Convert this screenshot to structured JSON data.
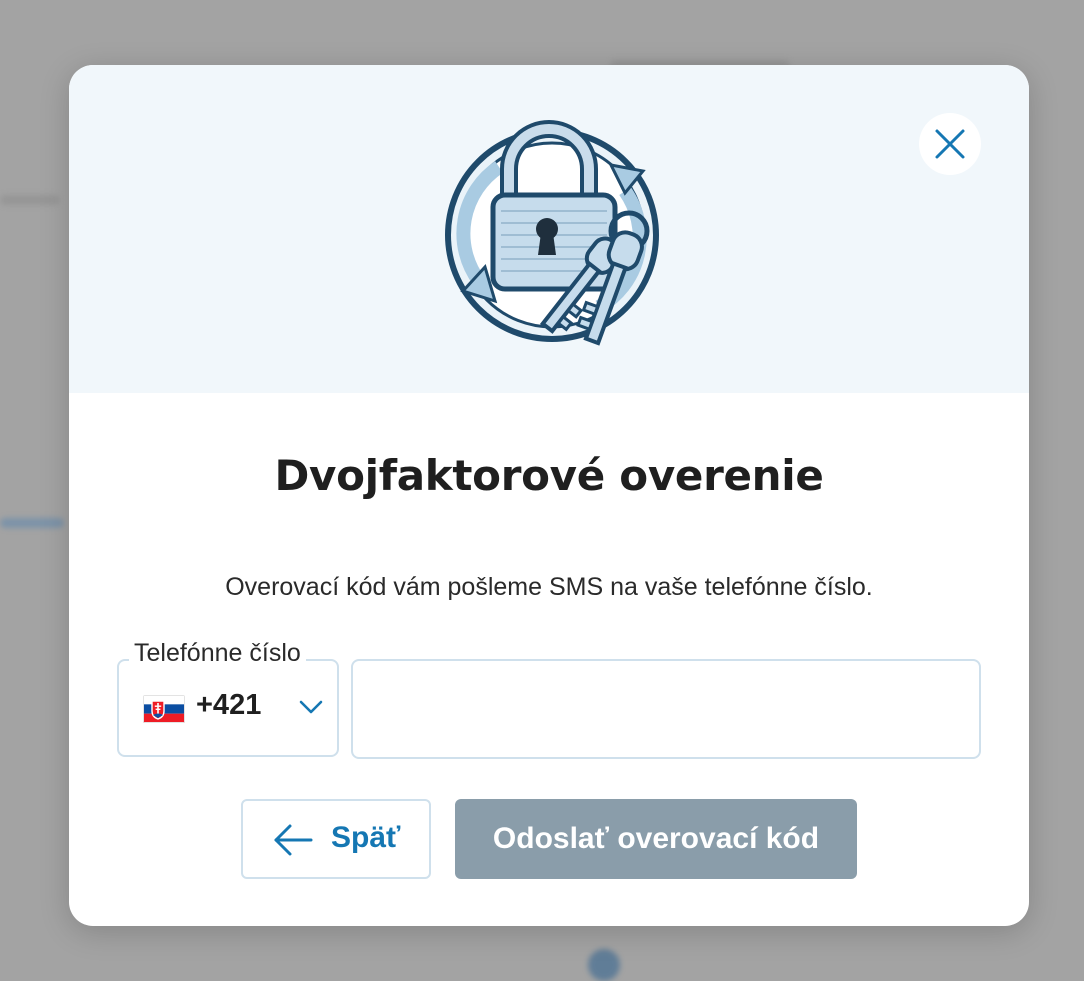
{
  "modal": {
    "title": "Dvojfaktorové overenie",
    "description": "Overovací kód vám pošleme SMS na vaše telefónne číslo.",
    "phone": {
      "label": "Telefónne číslo",
      "country_code": "+421",
      "country_flag": "slovakia-flag-icon",
      "value": "",
      "placeholder": ""
    },
    "buttons": {
      "back_label": "Späť",
      "send_label": "Odoslať overovací kód"
    },
    "icons": {
      "close": "close-icon",
      "illustration": "lock-keys-illustration",
      "back": "arrow-left-icon",
      "dropdown": "chevron-down-icon"
    }
  },
  "colors": {
    "accent": "#1577b3",
    "send_button_disabled": "#8a9daa",
    "header_background": "#f1f7fb",
    "input_border": "#cfe0ec",
    "overlay": "#a3a3a3"
  }
}
